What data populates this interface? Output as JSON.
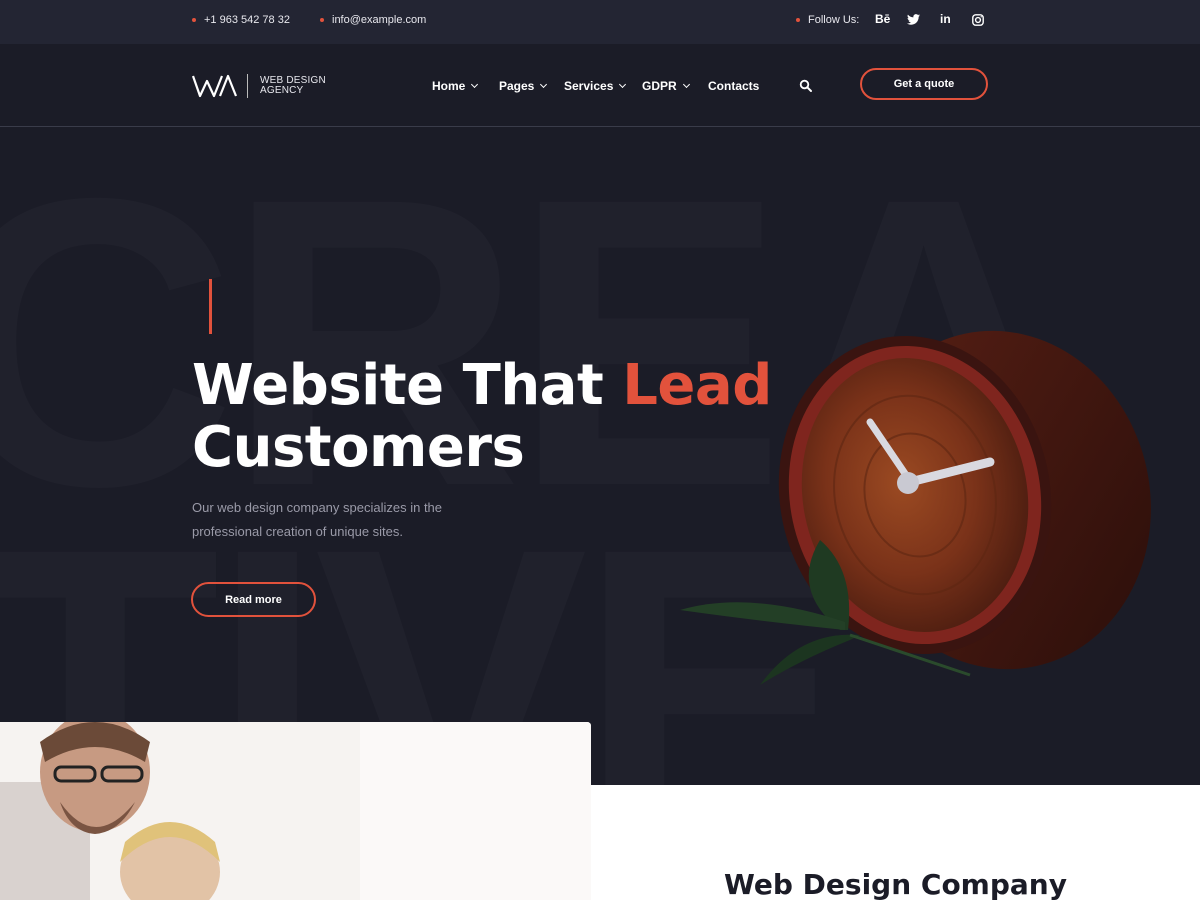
{
  "topbar": {
    "phone": "+1 963 542 78 32",
    "email": "info@example.com",
    "follow_label": "Follow Us:",
    "socials": [
      {
        "name": "behance",
        "label": "Bē"
      },
      {
        "name": "twitter",
        "label": ""
      },
      {
        "name": "linkedin",
        "label": "in"
      },
      {
        "name": "instagram",
        "label": ""
      }
    ]
  },
  "header": {
    "logo_mark": "WA",
    "logo_line1": "WEB DESIGN",
    "logo_line2": "AGENCY",
    "nav": [
      {
        "label": "Home",
        "dropdown": true
      },
      {
        "label": "Pages",
        "dropdown": true
      },
      {
        "label": "Services",
        "dropdown": true
      },
      {
        "label": "GDPR",
        "dropdown": true
      },
      {
        "label": "Contacts",
        "dropdown": false
      }
    ],
    "cta_label": "Get a quote"
  },
  "hero": {
    "background_words": [
      "CREA",
      "TIVE"
    ],
    "title_part1": "Website That",
    "title_highlight": "Lead",
    "title_part2": "Customers",
    "description": "Our web design company specializes in the professional creation of unique sites.",
    "button_label": "Read more"
  },
  "about": {
    "title": "Web Design Company"
  },
  "colors": {
    "accent": "#e2523c",
    "background": "#1b1c27",
    "topbar": "#232533"
  }
}
